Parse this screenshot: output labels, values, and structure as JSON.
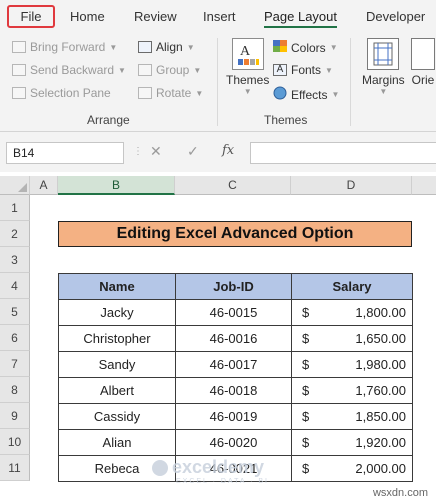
{
  "ribbon_tabs": {
    "file": "File",
    "home": "Home",
    "review": "Review",
    "insert": "Insert",
    "page_layout": "Page Layout",
    "developer": "Developer"
  },
  "arrange": {
    "bring_forward": "Bring Forward",
    "send_backward": "Send Backward",
    "selection_pane": "Selection Pane",
    "align": "Align",
    "group": "Group",
    "rotate": "Rotate",
    "label": "Arrange"
  },
  "themes": {
    "themes_button": "Themes",
    "colors": "Colors",
    "fonts": "Fonts",
    "effects": "Effects",
    "label": "Themes"
  },
  "page_setup": {
    "margins": "Margins",
    "orientation_partial": "Orie"
  },
  "formula_bar": {
    "name_box": "B14",
    "cancel": "✕",
    "enter": "✓",
    "fx": "fx",
    "value": ""
  },
  "columns": [
    "A",
    "B",
    "C",
    "D"
  ],
  "rows": [
    "1",
    "2",
    "3",
    "4",
    "5",
    "6",
    "7",
    "8",
    "9",
    "10",
    "11"
  ],
  "sheet": {
    "title": "Editing Excel Advanced Option",
    "headers": [
      "Name",
      "Job-ID",
      "Salary"
    ],
    "currency_symbol": "$",
    "records": [
      {
        "name": "Jacky",
        "job_id": "46-0015",
        "salary": "1,800.00"
      },
      {
        "name": "Christopher",
        "job_id": "46-0016",
        "salary": "1,650.00"
      },
      {
        "name": "Sandy",
        "job_id": "46-0017",
        "salary": "1,980.00"
      },
      {
        "name": "Albert",
        "job_id": "46-0018",
        "salary": "1,760.00"
      },
      {
        "name": "Cassidy",
        "job_id": "46-0019",
        "salary": "1,850.00"
      },
      {
        "name": "Alian",
        "job_id": "46-0020",
        "salary": "1,920.00"
      },
      {
        "name": "Rebeca",
        "job_id": "46-0021",
        "salary": "2,000.00"
      }
    ]
  },
  "watermark": {
    "brand": "exceldemy",
    "tagline": "EXCEL · DATA · BI"
  },
  "credit": "wsxdn.com",
  "colors": {
    "highlight": "#e0393e",
    "title_fill": "#f4b183",
    "header_fill": "#b4c6e7",
    "excel_green": "#217346"
  }
}
